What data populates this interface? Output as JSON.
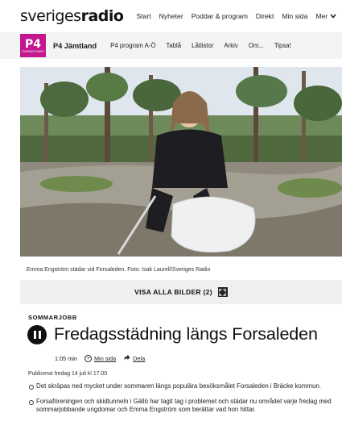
{
  "brand": {
    "logo_text_a": "sveriges",
    "logo_text_b": "radio"
  },
  "topnav": {
    "items": [
      "Start",
      "Nyheter",
      "Poddar & program",
      "Direkt",
      "Min sida"
    ],
    "more_label": "Mer"
  },
  "channel": {
    "logo_big": "P4",
    "logo_small": "SVERIGES RADIO",
    "name": "P4 Jämtland",
    "items": [
      "P4 program A-Ö",
      "Tablå",
      "Låtlistor",
      "Arkiv",
      "Om...",
      "Tipsa!"
    ]
  },
  "photo": {
    "caption": "Emma Engström städar vid Forsaleden. Foto: Isak Laurell/Sveriges Radio",
    "gallery_label": "VISA ALLA BILDER (2)"
  },
  "article": {
    "kicker": "SOMMARJOBB",
    "title": "Fredagsstädning längs Forsaleden",
    "duration": "1:05 min",
    "add_label": "Min sida",
    "share_label": "Dela",
    "published": "Publicerat fredag 14 juli kl 17.00",
    "bullets": [
      "Det skräpas ned mycket under sommaren längs populära besöksmålet Forsaleden i Bräcke kommun.",
      "Forsaföreningen och skidtunneln i Gällö har tagit tag i problemet och städar nu området varje fredag med sommarjobbande ungdomar och Emma Engström som berättar vad hon hittar."
    ]
  },
  "colors": {
    "brand_pink": "#c4178f",
    "text": "#1a1a1a",
    "bar_bg": "#efefef"
  },
  "icons": [
    "chevron-down-icon",
    "expand-icon",
    "pause-icon",
    "add-circle-icon",
    "share-arrow-icon"
  ]
}
